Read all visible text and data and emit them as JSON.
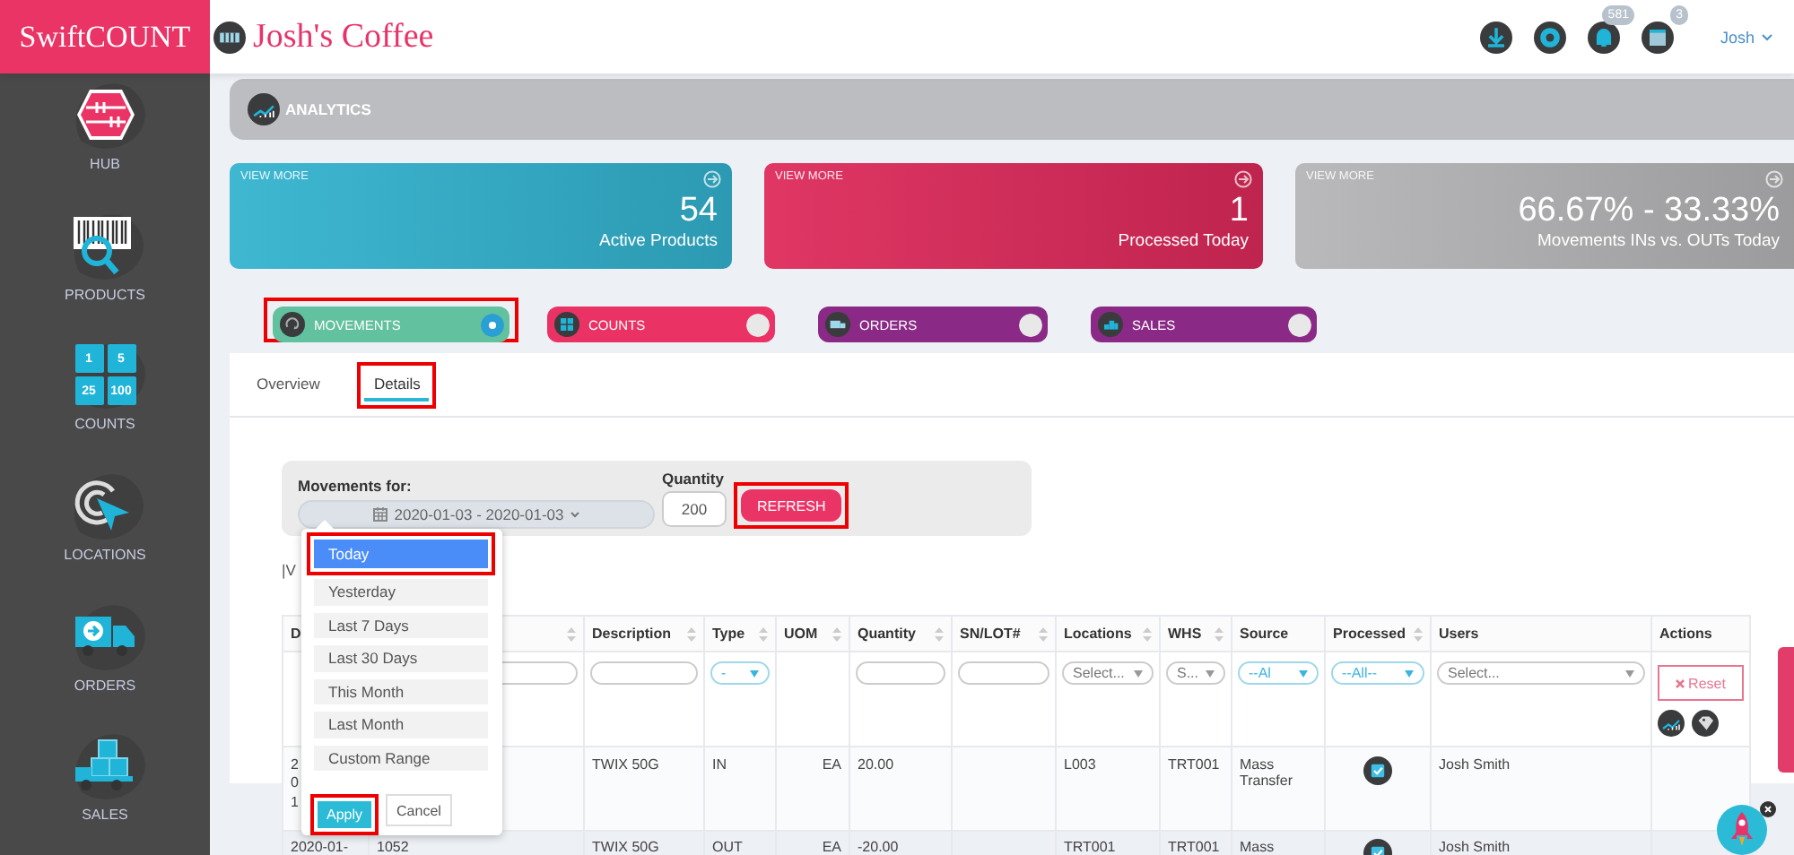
{
  "app": {
    "logo": "SwiftCOUNT",
    "company": "Josh's Coffee"
  },
  "header": {
    "icons": [
      {
        "kind": "download"
      },
      {
        "kind": "settings"
      },
      {
        "kind": "bell",
        "badge": "581"
      },
      {
        "kind": "calendar",
        "badge": "3"
      }
    ],
    "user": "Josh"
  },
  "sidebar": {
    "items": [
      {
        "kind": "hub",
        "label": "HUB"
      },
      {
        "kind": "products",
        "label": "PRODUCTS"
      },
      {
        "kind": "counts",
        "label": "COUNTS",
        "tiles": [
          "1",
          "5",
          "25",
          "100"
        ]
      },
      {
        "kind": "locations",
        "label": "LOCATIONS"
      },
      {
        "kind": "orders",
        "label": "ORDERS"
      },
      {
        "kind": "sales",
        "label": "SALES"
      }
    ]
  },
  "analytics": {
    "title": "ANALYTICS"
  },
  "cards": [
    {
      "link": "VIEW MORE",
      "value": "54",
      "label": "Active Products",
      "color": "#33b3cf"
    },
    {
      "link": "VIEW MORE",
      "value": "1",
      "label": "Processed Today",
      "color": "#de2a5b"
    },
    {
      "link": "VIEW MORE",
      "value": "66.67% - 33.33%",
      "label": "Movements INs vs. OUTs Today",
      "color": "#b5b5b7"
    }
  ],
  "modules": [
    {
      "kind": "movements",
      "label": "MOVEMENTS",
      "color": "#62c19e",
      "on": true,
      "highlighted": true
    },
    {
      "kind": "counts",
      "label": "COUNTS",
      "color": "#ea3264",
      "on": false,
      "highlighted": false
    },
    {
      "kind": "orders",
      "label": "ORDERS",
      "color": "#8a2a86",
      "on": false,
      "highlighted": false
    },
    {
      "kind": "sales",
      "label": "SALES",
      "color": "#8a2a86",
      "on": false,
      "highlighted": false
    }
  ],
  "tabs": [
    {
      "label": "Overview",
      "selected": false,
      "highlighted": false
    },
    {
      "label": "Details",
      "selected": true,
      "highlighted": true
    }
  ],
  "filter": {
    "label": "Movements for:",
    "date_range": "2020-01-03 - 2020-01-03",
    "quantity_label": "Quantity",
    "quantity": "200",
    "refresh": "REFRESH",
    "refresh_highlighted": true
  },
  "date_menu": {
    "options": [
      {
        "label": "Today",
        "selected": true,
        "highlighted": true
      },
      {
        "label": "Yesterday",
        "selected": false,
        "highlighted": false
      },
      {
        "label": "Last 7 Days",
        "selected": false,
        "highlighted": false
      },
      {
        "label": "Last 30 Days",
        "selected": false,
        "highlighted": false
      },
      {
        "label": "This Month",
        "selected": false,
        "highlighted": false
      },
      {
        "label": "Last Month",
        "selected": false,
        "highlighted": false
      },
      {
        "label": "Custom Range",
        "selected": false,
        "highlighted": false
      }
    ],
    "apply": "Apply",
    "apply_highlighted": true,
    "cancel": "Cancel"
  },
  "view_fragment": "|V",
  "table": {
    "columns": [
      {
        "label": "D"
      },
      {
        "sortable": true
      },
      {
        "label": "Description",
        "sortable": true
      },
      {
        "label": "Type",
        "sortable": true
      },
      {
        "label": "UOM",
        "sortable": true
      },
      {
        "label": "Quantity",
        "sortable": true
      },
      {
        "label": "SN/LOT#",
        "sortable": true
      },
      {
        "label": "Locations",
        "sortable": true
      },
      {
        "label": "WHS",
        "sortable": true
      },
      {
        "label": "Source",
        "sortable": false
      },
      {
        "label": "Processed",
        "sortable": true
      },
      {
        "label": "Users",
        "sortable": false
      },
      {
        "label": "Actions",
        "sortable": false
      }
    ],
    "filters": [
      {
        "kind": "none"
      },
      {
        "kind": "text"
      },
      {
        "kind": "text"
      },
      {
        "kind": "select",
        "value": "-",
        "active": true
      },
      {
        "kind": "none"
      },
      {
        "kind": "text"
      },
      {
        "kind": "text"
      },
      {
        "kind": "select",
        "value": "Select...",
        "active": false
      },
      {
        "kind": "select",
        "value": "S...",
        "active": false
      },
      {
        "kind": "select",
        "value": "--Al",
        "active": true
      },
      {
        "kind": "select",
        "value": "--All--",
        "active": true
      },
      {
        "kind": "select",
        "value": "Select...",
        "active": false
      },
      {
        "kind": "reset",
        "value": "Reset"
      }
    ],
    "rows": [
      {
        "cells": [
          "201",
          null,
          "TWIX 50G",
          "IN",
          "EA",
          "20.00",
          null,
          "L003",
          "TRT001",
          "Mass Transfer",
          {
            "kind": "check",
            "checked": true
          },
          "Josh Smith",
          null
        ]
      },
      {
        "cells": [
          "2020-01-",
          "1052",
          "TWIX 50G",
          "OUT",
          "EA",
          "-20.00",
          null,
          "TRT001",
          "TRT001",
          "Mass",
          {
            "kind": "check",
            "checked": true
          },
          "Josh Smith",
          null
        ]
      }
    ]
  }
}
